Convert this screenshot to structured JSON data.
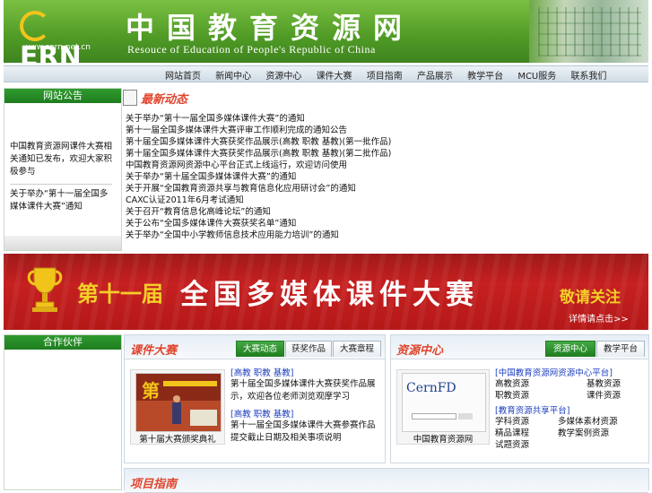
{
  "header": {
    "logo_text": "ERN",
    "logo_letter": "C",
    "site_url": "www.cern.net.cn",
    "title": "中国教育资源网",
    "subtitle": "Resouce of Education of People's Republic of China"
  },
  "nav": {
    "items": [
      "网站首页",
      "新闻中心",
      "资源中心",
      "课件大赛",
      "项目指南",
      "产品展示",
      "教学平台",
      "MCU服务",
      "联系我们"
    ]
  },
  "sidebar_notice": {
    "title": "网站公告",
    "items": [
      "中国教育资源网课件大赛相关通知已发布，欢迎大家积极参与",
      "关于举办“第十一届全国多媒体课件大赛”通知"
    ]
  },
  "news": {
    "title": "最新动态",
    "items": [
      "关于举办“第十一届全国多媒体课件大赛”的通知",
      "第十一届全国多媒体课件大赛评审工作顺利完成的通知公告",
      "第十届全国多媒体课件大赛获奖作品展示(高教 职教 基教)(第一批作品)",
      "第十届全国多媒体课件大赛获奖作品展示(高教 职教 基教)(第二批作品)",
      "中国教育资源网资源中心平台正式上线运行，欢迎访问使用",
      "关于举办“第十届全国多媒体课件大赛”的通知",
      "关于开展“全国教育资源共享与教育信息化应用研讨会”的通知",
      "CAXC认证2011年6月考试通知",
      "关于召开“教育信息化高峰论坛”的通知",
      "关于公布“全国多媒体课件大赛获奖名单”通知",
      "关于举办“全国中小学教师信息技术应用能力培训”的通知"
    ]
  },
  "banner": {
    "edition": "第十一届",
    "name": "全国多媒体课件大赛",
    "slogan": "敬请关注",
    "link": "详情请点击>>"
  },
  "sidebar_partner": {
    "title": "合作伙伴"
  },
  "panel_contest": {
    "title": "课件大赛",
    "tabs": [
      "大赛动态",
      "获奖作品",
      "大赛章程"
    ],
    "thumb_caption": "第十届大赛颁奖典礼",
    "thumb_banner_char": "第",
    "entries": [
      {
        "tag": "[高教 职教 基教]",
        "text": "第十届全国多媒体课件大赛获奖作品展示，欢迎各位老师浏览观摩学习"
      },
      {
        "tag": "[高教 职教 基教]",
        "text": "第十一届全国多媒体课件大赛参赛作品提交截止日期及相关事项说明"
      }
    ]
  },
  "panel_resource": {
    "title": "资源中心",
    "tabs": [
      "资源中心",
      "教学平台"
    ],
    "thumb_text": "CernFD",
    "thumb_caption": "中国教育资源网",
    "groups": [
      {
        "tag": "[中国教育资源网资源中心平台]",
        "items": [
          "高教资源",
          "基教资源",
          "职教资源",
          "课件资源"
        ]
      },
      {
        "tag": "[教育资源共享平台]",
        "items": [
          "学科资源",
          "多媒体素材资源",
          "精品课程",
          "教学案例资源",
          "试题资源"
        ]
      }
    ]
  },
  "panel_guide": {
    "title": "项目指南"
  },
  "colors": {
    "brand_green": "#2f9a2f",
    "accent_red": "#e0452e",
    "banner_red": "#c62020",
    "link_blue": "#1e3fbf"
  }
}
